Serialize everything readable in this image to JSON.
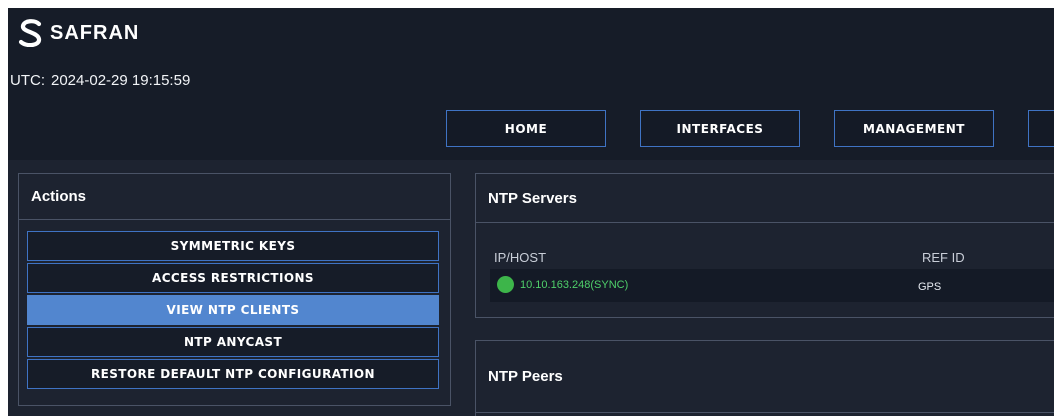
{
  "brand": {
    "name": "SAFRAN",
    "logo_icon": "safran-s-logo-icon"
  },
  "clock": {
    "label": "UTC:",
    "value": "2024-02-29 19:15:59"
  },
  "nav": [
    {
      "label": "HOME"
    },
    {
      "label": "INTERFACES"
    },
    {
      "label": "MANAGEMENT"
    },
    {
      "label": ""
    }
  ],
  "actions": {
    "title": "Actions",
    "items": [
      {
        "label": "SYMMETRIC KEYS",
        "active": false
      },
      {
        "label": "ACCESS RESTRICTIONS",
        "active": false
      },
      {
        "label": "VIEW NTP CLIENTS",
        "active": true
      },
      {
        "label": "NTP ANYCAST",
        "active": false
      },
      {
        "label": "RESTORE DEFAULT NTP CONFIGURATION",
        "active": false
      }
    ]
  },
  "servers": {
    "title": "NTP Servers",
    "columns": [
      "IP/HOST",
      "REF ID"
    ],
    "rows": [
      {
        "status": "sync",
        "status_color": "#3db54a",
        "ip": "10.10.163.248",
        "sync": "(SYNC)",
        "ref_id": "GPS"
      }
    ]
  },
  "peers": {
    "title": "NTP Peers"
  },
  "colors": {
    "accent": "#3f73c4",
    "active": "#5286cf",
    "ok": "#3db54a",
    "background": "#1d2330"
  }
}
